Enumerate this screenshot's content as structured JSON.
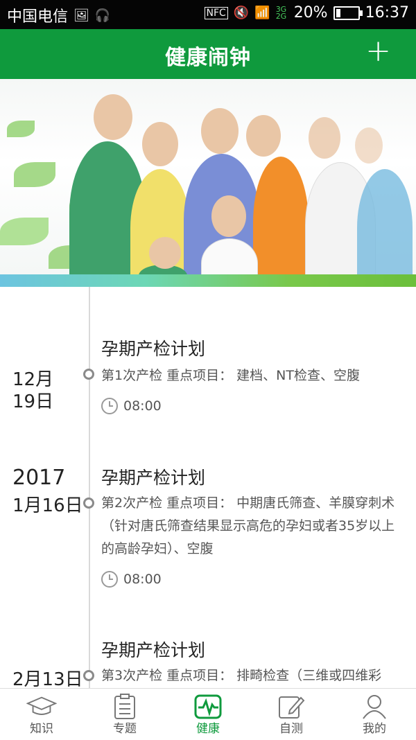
{
  "statusbar": {
    "carrier": "中国电信",
    "nfc": "NFC",
    "network": "3G 2G",
    "battery": "20%",
    "time": "16:37",
    "battery_level": 0.2
  },
  "header": {
    "title": "健康闹钟",
    "add_label": "+"
  },
  "timeline": {
    "events": [
      {
        "year": "",
        "date": "12月19日",
        "title": "孕期产检计划",
        "desc": "第1次产检 重点项目： 建档、NT检查、空腹",
        "time": "08:00"
      },
      {
        "year": "2017",
        "date": "1月16日",
        "title": "孕期产检计划",
        "desc": "第2次产检 重点项目： 中期唐氏筛查、羊膜穿刺术（针对唐氏筛查结果显示高危的孕妇或者35岁以上的高龄孕妇）、空腹",
        "time": "08:00"
      },
      {
        "year": "",
        "date": "2月13日",
        "title": "孕期产检计划",
        "desc": "第3次产检 重点项目： 排畸检查（三维或四维彩",
        "time": ""
      }
    ]
  },
  "tabs": [
    {
      "label": "知识",
      "icon": "graduation-cap-icon",
      "active": false
    },
    {
      "label": "专题",
      "icon": "clipboard-icon",
      "active": false
    },
    {
      "label": "健康",
      "icon": "heart-pulse-icon",
      "active": true
    },
    {
      "label": "自测",
      "icon": "edit-note-icon",
      "active": false
    },
    {
      "label": "我的",
      "icon": "person-icon",
      "active": false
    }
  ],
  "colors": {
    "brand_green": "#0f9a3d",
    "status_black": "#050505"
  }
}
